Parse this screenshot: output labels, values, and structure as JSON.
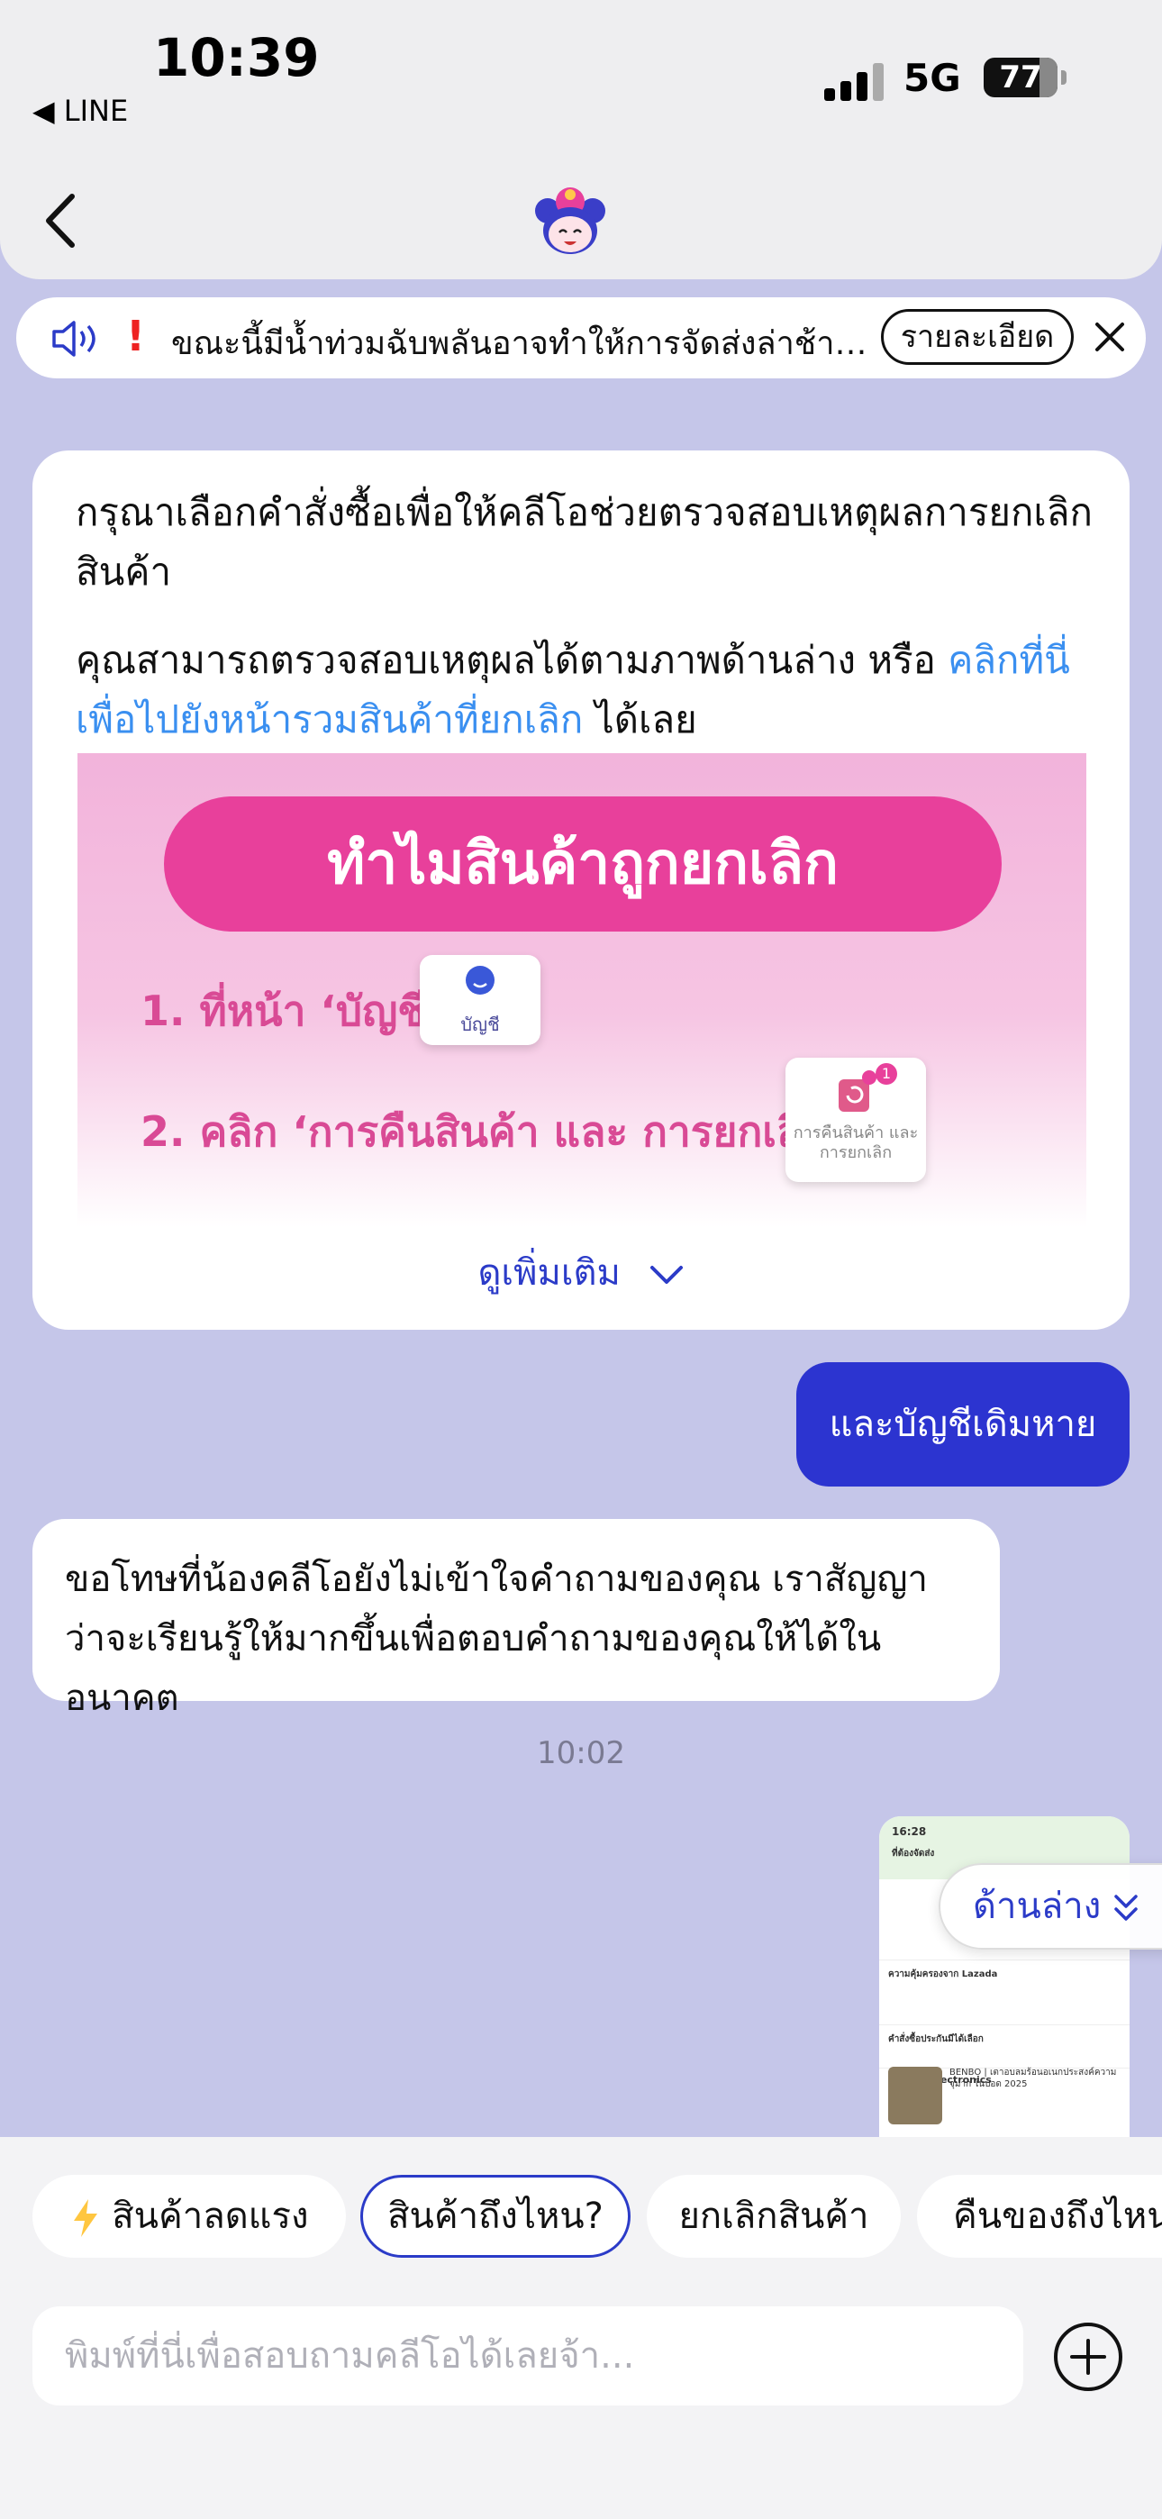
{
  "status_bar": {
    "time": "10:39",
    "back_app": "◀ LINE",
    "network": "5G",
    "battery": "77"
  },
  "notice": {
    "message": "ขณะนี้มีน้ำท่วมฉับพลันอาจทำให้การจัดส่งล่าช้าในบางพื้...",
    "detail_button": "รายละเอียด"
  },
  "bot_card": {
    "paragraph1": "กรุณาเลือกคำสั่งซื้อเพื่อให้คลีโอช่วยตรวจสอบเหตุผลการยกเลิกสินค้า",
    "paragraph2_prefix": "คุณสามารถตรวจสอบเหตุผลได้ตามภาพด้านล่าง หรือ ",
    "paragraph2_link": "คลิกที่นี่เพื่อไปยังหน้ารวมสินค้าที่ยกเลิก",
    "paragraph2_suffix": " ได้เลย",
    "promo": {
      "title": "ทำไมสินค้าถูกยกเลิก",
      "step1": "1. ที่หน้า ‘บัญชี’",
      "step1_tile": "บัญชี",
      "step2": "2. คลิก ‘การคืนสินค้า และ การยกเลิก’",
      "step2_tile": "การคืนสินค้า และ การยกเลิก",
      "step2_badge": "1"
    },
    "see_more": "ดูเพิ่มเติม"
  },
  "user_message": "และบัญชีเดิมหาย",
  "bot_reply": "ขอโทษที่น้องคลีโอยังไม่เข้าใจคำถามของคุณ เราสัญญาว่าจะเรียนรู้ให้มากขึ้นเพื่อตอบคำถามของคุณให้ได้ในอนาคต",
  "timestamp": "10:02",
  "thumbnail": {
    "time": "16:28",
    "title": "ที่ต้องจัดส่ง",
    "row1": "ความคุ้มครองจาก Lazada",
    "row2": "คำสั่งซื้อประกันมีได้เลือก",
    "shop": "BENBO Electronics",
    "product": "BENBO | เตาอบลมร้อนอเนกประสงค์ความจุมาก ในปอด 2025"
  },
  "jump_button": "ด้านล่าง",
  "quick_replies": [
    "สินค้าลดแรง",
    "สินค้าถึงไหน?",
    "ยกเลิกสินค้า",
    "คืนของถึงไหน"
  ],
  "input_placeholder": "พิมพ์ที่นี่เพื่อสอบถามคลีโอได้เลยจ้า...",
  "colors": {
    "accent": "#2c34d0",
    "background": "#c5c6e9",
    "link": "#3a8ff0",
    "promo_pink": "#e8409b"
  },
  "icons": [
    "back-icon",
    "mascot-icon",
    "speaker-icon",
    "exclamation-icon",
    "close-icon",
    "chevron-down-icon",
    "double-chevron-down-icon",
    "lightning-icon",
    "plus-icon"
  ]
}
